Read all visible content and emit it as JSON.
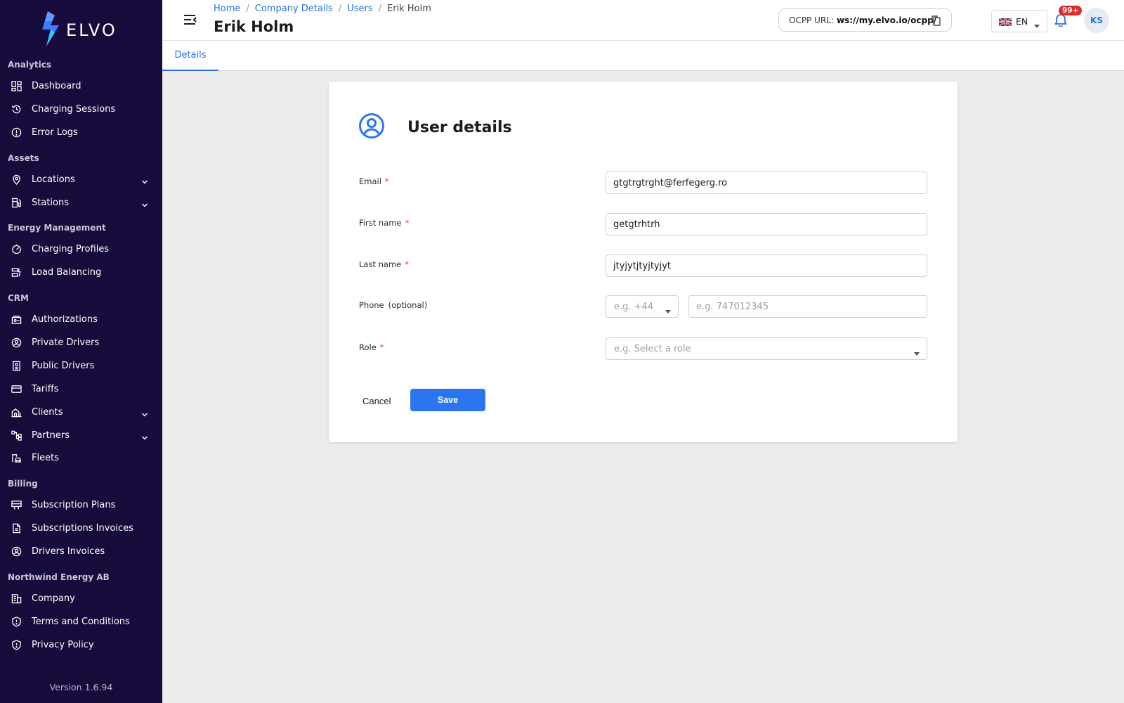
{
  "brand": {
    "name": "ELVO",
    "version": "Version 1.6.94"
  },
  "sidebar": {
    "sections": [
      {
        "title": "Analytics",
        "items": [
          {
            "label": "Dashboard",
            "icon": "dashboard-icon"
          },
          {
            "label": "Charging Sessions",
            "icon": "history-icon"
          },
          {
            "label": "Error Logs",
            "icon": "alert-circle-icon"
          }
        ]
      },
      {
        "title": "Assets",
        "items": [
          {
            "label": "Locations",
            "icon": "map-pin-icon",
            "expandable": true
          },
          {
            "label": "Stations",
            "icon": "charging-station-icon",
            "expandable": true
          }
        ]
      },
      {
        "title": "Energy Management",
        "items": [
          {
            "label": "Charging Profiles",
            "icon": "gauge-icon"
          },
          {
            "label": "Load Balancing",
            "icon": "load-balancing-icon"
          }
        ]
      },
      {
        "title": "CRM",
        "items": [
          {
            "label": "Authorizations",
            "icon": "authorization-icon"
          },
          {
            "label": "Private Drivers",
            "icon": "user-circle-icon"
          },
          {
            "label": "Public Drivers",
            "icon": "badge-icon"
          },
          {
            "label": "Tariffs",
            "icon": "credit-card-icon"
          },
          {
            "label": "Clients",
            "icon": "building-icon",
            "expandable": true
          },
          {
            "label": "Partners",
            "icon": "hierarchy-icon",
            "expandable": true
          },
          {
            "label": "Fleets",
            "icon": "fleet-icon"
          }
        ]
      },
      {
        "title": "Billing",
        "items": [
          {
            "label": "Subscription Plans",
            "icon": "plans-icon"
          },
          {
            "label": "Subscriptions Invoices",
            "icon": "document-icon"
          },
          {
            "label": "Drivers Invoices",
            "icon": "user-circle-icon"
          }
        ]
      },
      {
        "title": "Northwind Energy AB",
        "items": [
          {
            "label": "Company",
            "icon": "company-icon"
          },
          {
            "label": "Terms and Conditions",
            "icon": "shield-icon"
          },
          {
            "label": "Privacy Policy",
            "icon": "shield-icon"
          }
        ]
      }
    ]
  },
  "header": {
    "breadcrumb": [
      "Home",
      "Company Details",
      "Users",
      "Erik Holm"
    ],
    "title": "Erik Holm",
    "ocpp_label": "OCPP URL:",
    "ocpp_value": "ws://my.elvo.io/ocpp/",
    "language": "EN",
    "notifications_badge": "99+",
    "user_initials": "KS"
  },
  "tabs": {
    "details": "Details"
  },
  "form": {
    "title": "User details",
    "email_label": "Email",
    "email_value": "gtgtrgtrght@ferfegerg.ro",
    "first_name_label": "First name",
    "first_name_value": "getgtrhtrh",
    "last_name_label": "Last name",
    "last_name_value": "jtyjytjtyjtyjyt",
    "phone_label": "Phone",
    "phone_optional": "(optional)",
    "phone_prefix_placeholder": "e.g. +44",
    "phone_number_placeholder": "e.g. 747012345",
    "role_label": "Role",
    "role_placeholder": "e.g. Select a role",
    "required_mark": "*",
    "cancel": "Cancel",
    "save": "Save"
  },
  "colors": {
    "sidebar_bg": "#170b3b",
    "accent": "#2b76f0",
    "required": "#e0453a",
    "badge": "#e02a2a"
  }
}
